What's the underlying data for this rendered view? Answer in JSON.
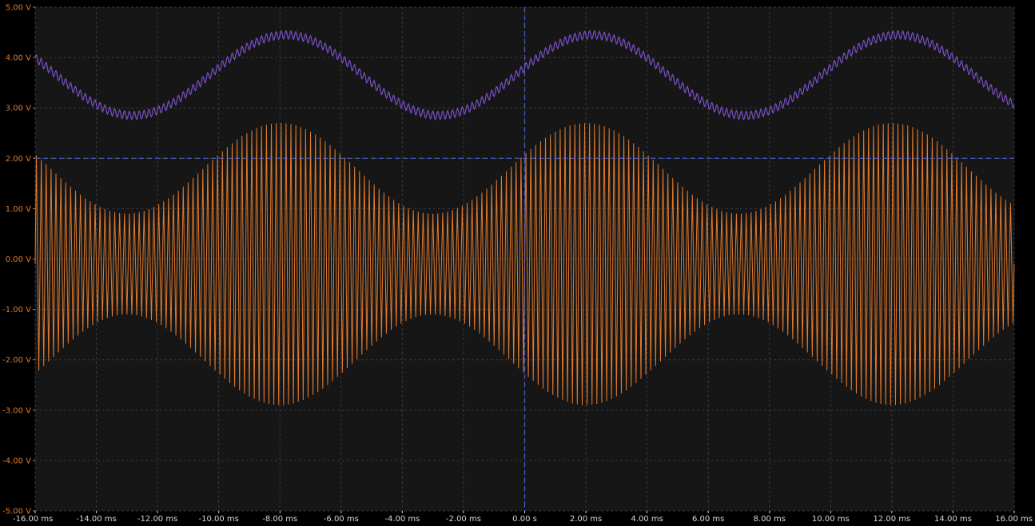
{
  "chart_data": {
    "type": "line",
    "title": "",
    "xlabel": "",
    "ylabel": "",
    "x_range_ms": [
      -16,
      16
    ],
    "y_range_v": [
      -5,
      5
    ],
    "grid": true,
    "legend": "none",
    "x_ticks": [
      {
        "value": -16,
        "label": "-16.00 ms"
      },
      {
        "value": -14,
        "label": "-14.00 ms"
      },
      {
        "value": -12,
        "label": "-12.00 ms"
      },
      {
        "value": -10,
        "label": "-10.00 ms"
      },
      {
        "value": -8,
        "label": "-8.00 ms"
      },
      {
        "value": -6,
        "label": "-6.00 ms"
      },
      {
        "value": -4,
        "label": "-4.00 ms"
      },
      {
        "value": -2,
        "label": "-2.00 ms"
      },
      {
        "value": 0,
        "label": "0.00 s"
      },
      {
        "value": 2,
        "label": "2.00 ms"
      },
      {
        "value": 4,
        "label": "4.00 ms"
      },
      {
        "value": 6,
        "label": "6.00 ms"
      },
      {
        "value": 8,
        "label": "8.00 ms"
      },
      {
        "value": 10,
        "label": "10.00 ms"
      },
      {
        "value": 12,
        "label": "12.00 ms"
      },
      {
        "value": 14,
        "label": "14.00 ms"
      },
      {
        "value": 16,
        "label": "16.00 ms"
      }
    ],
    "y_ticks": [
      {
        "value": 5,
        "label": "5.00 V"
      },
      {
        "value": 4,
        "label": "4.00 V"
      },
      {
        "value": 3,
        "label": "3.00 V"
      },
      {
        "value": 2,
        "label": "2.00 V"
      },
      {
        "value": 1,
        "label": "1.00 V"
      },
      {
        "value": 0,
        "label": "0.00 V"
      },
      {
        "value": -1,
        "label": "-1.00 V"
      },
      {
        "value": -2,
        "label": "-2.00 V"
      },
      {
        "value": -3,
        "label": "-3.00 V"
      },
      {
        "value": -4,
        "label": "-4.00 V"
      },
      {
        "value": -5,
        "label": "-5.00 V"
      }
    ],
    "cursors": {
      "vertical_ms": 0,
      "horizontal_v": 2
    },
    "series": [
      {
        "key": "am_signal",
        "color": "#e07a2e",
        "kind": "amplitude-modulated carrier",
        "envelope_max_v": 2.7,
        "envelope_min_v": 0.9,
        "envelope_period_ms": 10,
        "envelope_peak_ms": 2,
        "carrier_period_ms": 0.16,
        "offset_v": -0.1
      },
      {
        "key": "sine_with_ripple",
        "color": "#7b4fc9",
        "kind": "sine with high-frequency ripple",
        "center_v": 3.65,
        "amplitude_v": 0.8,
        "period_ms": 10,
        "peak_ms": 2.2,
        "ripple_v": 0.08,
        "ripple_period_ms": 0.16
      }
    ],
    "colors": {
      "background": "#000000",
      "plot_background": "#161616",
      "grid": "#3a3a3a",
      "cursor": "#4a5fd0",
      "y_tick_text": "#e07a2e",
      "x_tick_text": "#d8d8d8"
    }
  }
}
